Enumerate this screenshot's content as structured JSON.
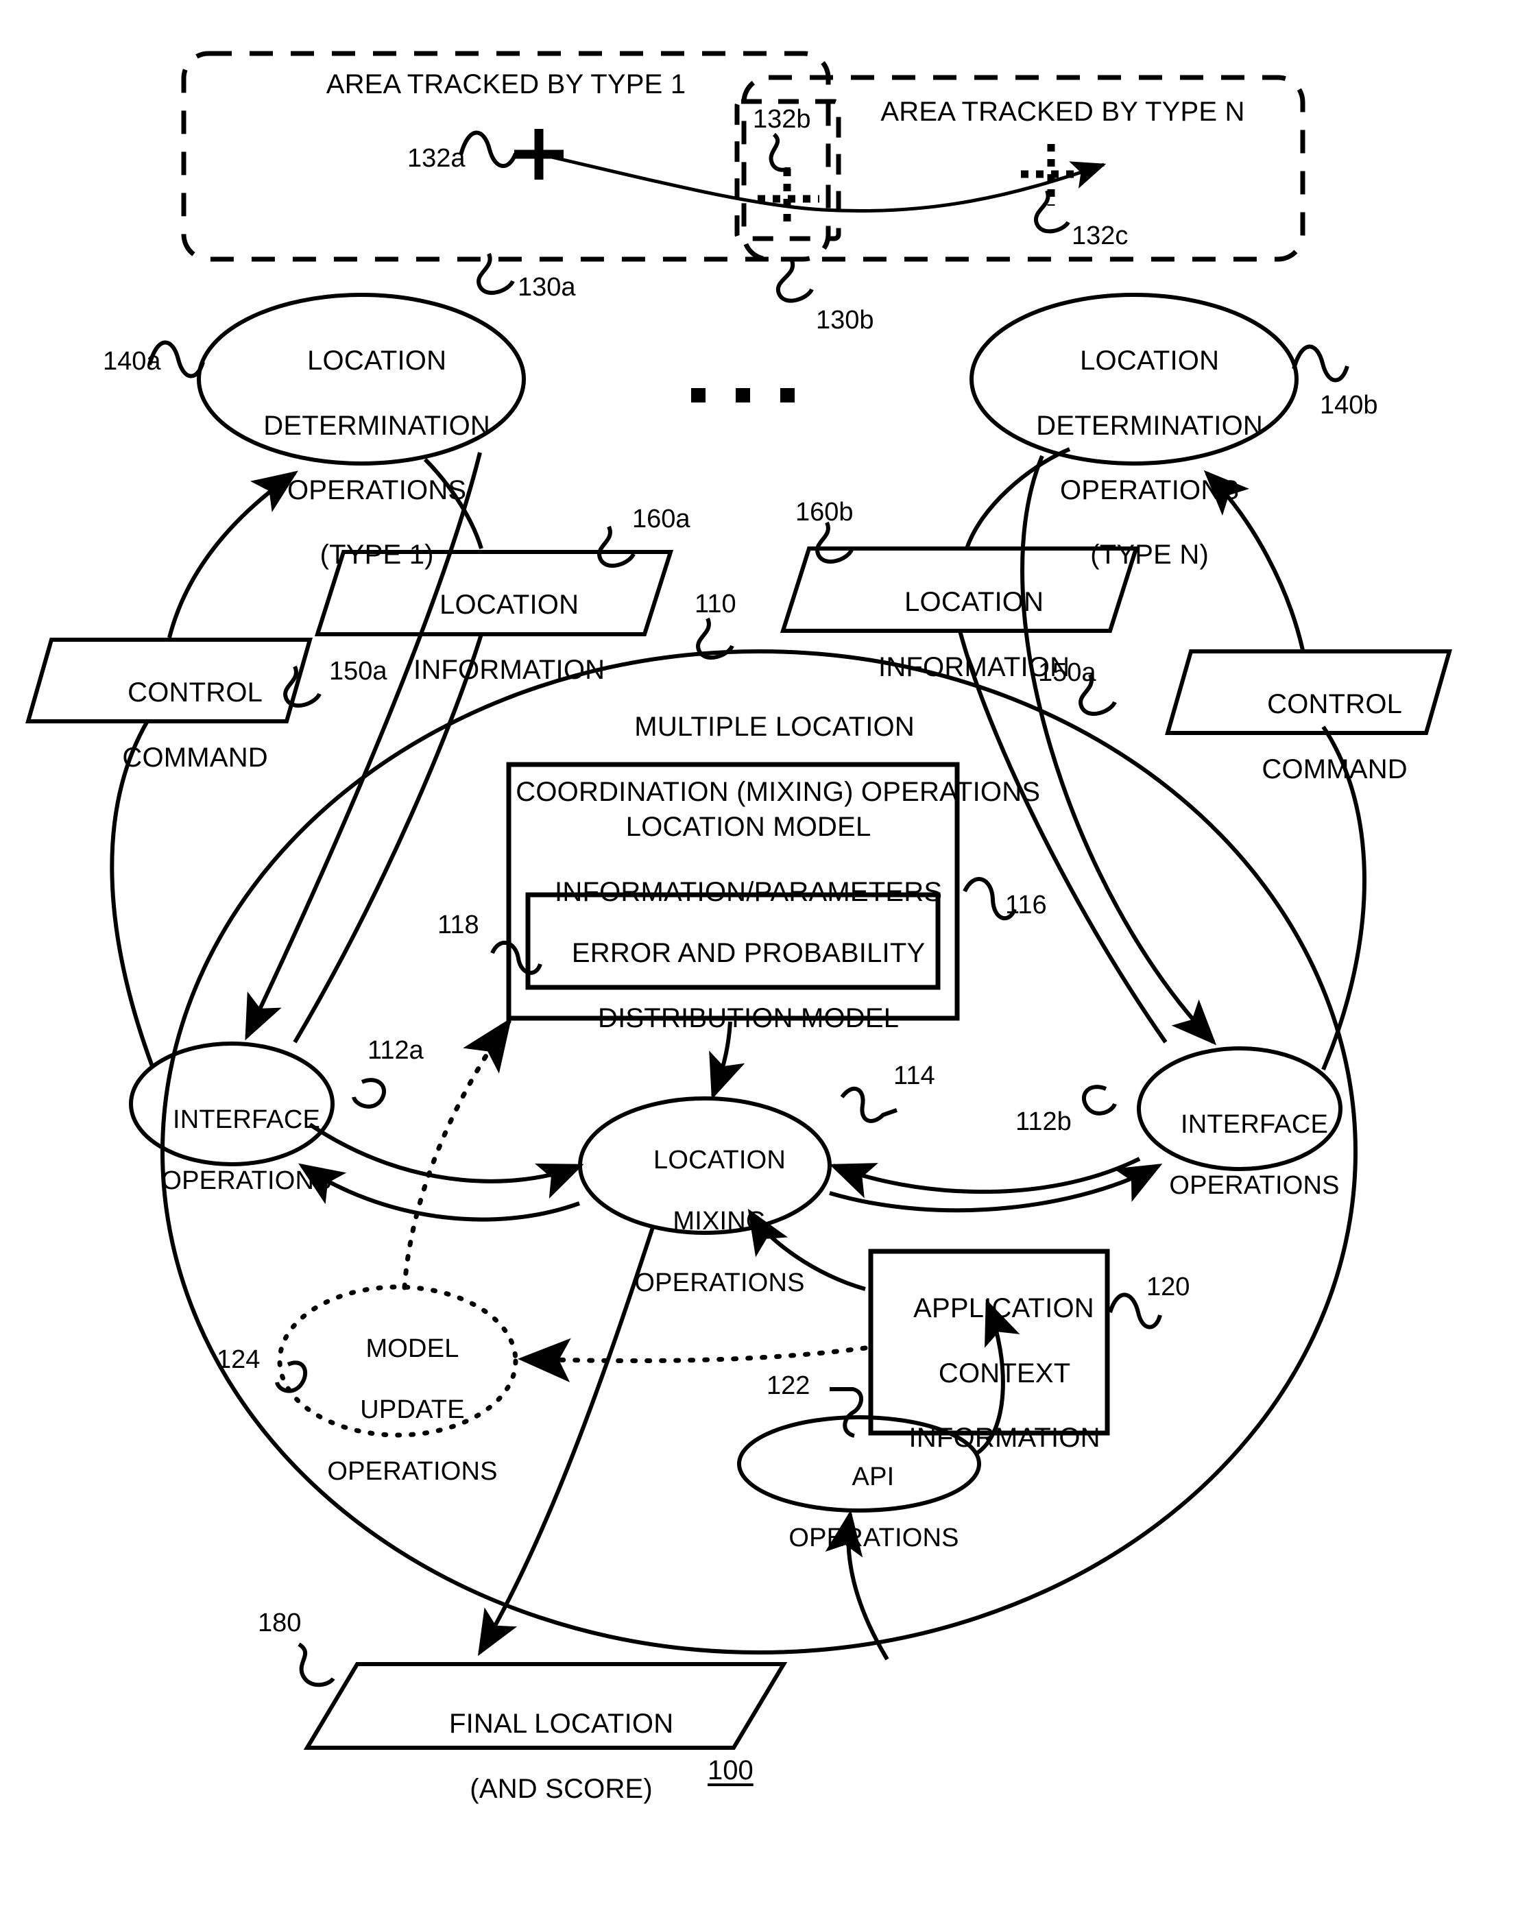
{
  "figure": {
    "number": "100"
  },
  "tracked_areas": [
    {
      "label": "AREA TRACKED BY TYPE 1",
      "ref": "130a"
    },
    {
      "label": "AREA TRACKED BY TYPE N",
      "ref": "130b"
    }
  ],
  "position_markers": [
    {
      "ref": "132a",
      "style": "solid-cross"
    },
    {
      "ref": "132b",
      "style": "dotted-cross"
    },
    {
      "ref": "132c",
      "style": "dotted-cross"
    }
  ],
  "determination_ops": [
    {
      "lines": [
        "LOCATION",
        "DETERMINATION",
        "OPERATIONS",
        "(TYPE 1)"
      ],
      "ref": "140a"
    },
    {
      "lines": [
        "LOCATION",
        "DETERMINATION",
        "OPERATIONS",
        "(TYPE N)"
      ],
      "ref": "140b"
    }
  ],
  "ellipsis_between_ops": "▪ ▪ ▪",
  "data_flows": {
    "location_information_left": {
      "lines": [
        "LOCATION",
        "INFORMATION"
      ],
      "ref": "160a"
    },
    "location_information_right": {
      "lines": [
        "LOCATION",
        "INFORMATION"
      ],
      "ref": "160b"
    },
    "control_command_left": {
      "lines": [
        "CONTROL",
        "COMMAND"
      ],
      "ref": "150a"
    },
    "control_command_right": {
      "lines": [
        "CONTROL",
        "COMMAND"
      ],
      "ref": "150a"
    }
  },
  "coordination": {
    "title_lines": [
      "MULTIPLE LOCATION",
      "COORDINATION (MIXING) OPERATIONS"
    ],
    "ref": "110",
    "model_box": {
      "lines": [
        "LOCATION MODEL",
        "INFORMATION/PARAMETERS"
      ],
      "ref": "116",
      "inner_box": {
        "lines": [
          "ERROR AND PROBABILITY",
          "DISTRIBUTION MODEL"
        ],
        "ref": "118"
      }
    },
    "interface_ops_left": {
      "lines": [
        "INTERFACE",
        "OPERATIONS"
      ],
      "ref": "112a"
    },
    "interface_ops_right": {
      "lines": [
        "INTERFACE",
        "OPERATIONS"
      ],
      "ref": "112b"
    },
    "mixing_ops": {
      "lines": [
        "LOCATION",
        "MIXING",
        "OPERATIONS"
      ],
      "ref": "114"
    },
    "model_update_ops": {
      "lines": [
        "MODEL",
        "UPDATE",
        "OPERATIONS"
      ],
      "ref": "124"
    },
    "app_context": {
      "lines": [
        "APPLICATION",
        "CONTEXT",
        "INFORMATION"
      ],
      "ref": "120"
    },
    "api_ops": {
      "lines": [
        "API",
        "OPERATIONS"
      ],
      "ref": "122"
    }
  },
  "output": {
    "final_location": {
      "lines": [
        "FINAL LOCATION",
        "(AND SCORE)"
      ],
      "ref": "180"
    }
  },
  "colors": {
    "ink": "#000000",
    "paper": "#ffffff"
  }
}
